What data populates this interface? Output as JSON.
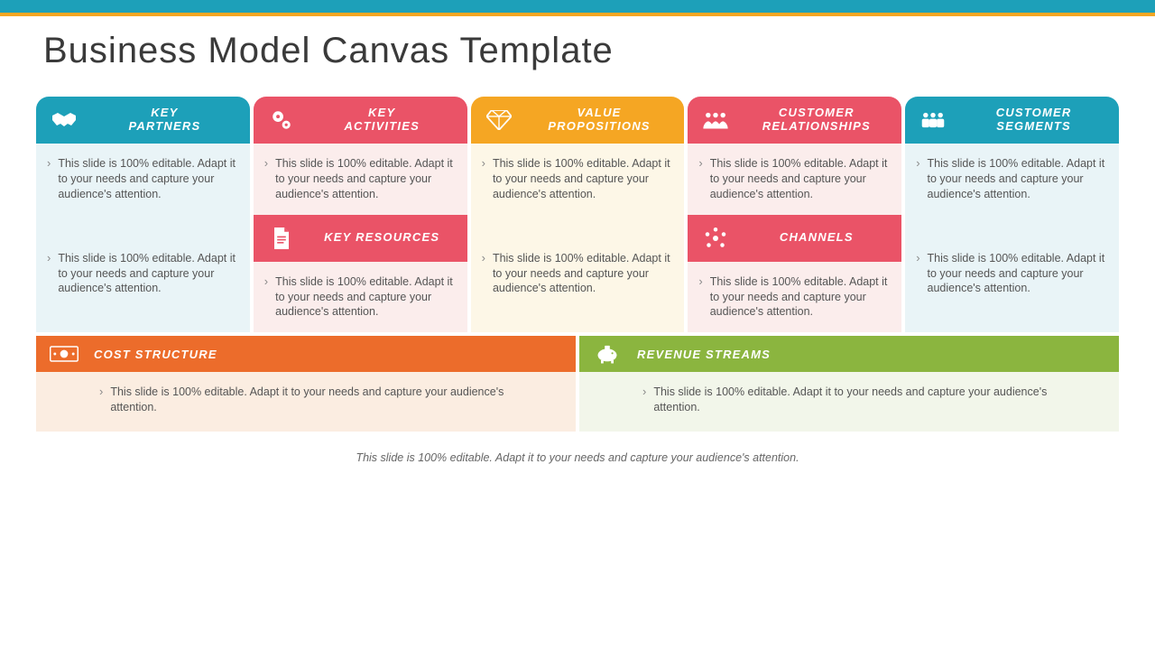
{
  "title": "Business Model Canvas Template",
  "placeholder": "This slide is 100% editable. Adapt it to your needs and capture your audience's attention.",
  "cards": {
    "key_partners": {
      "label": "KEY\nPARTNERS",
      "icon": "handshake-icon"
    },
    "key_activities": {
      "label": "KEY\nACTIVITIES",
      "icon": "gears-icon"
    },
    "value_propositions": {
      "label": "VALUE\nPROPOSITIONS",
      "icon": "diamond-icon"
    },
    "customer_relationships": {
      "label": "CUSTOMER\nRELATIONSHIPS",
      "icon": "people-team-icon"
    },
    "customer_segments": {
      "label": "CUSTOMER\nSEGMENTS",
      "icon": "people-group-icon"
    },
    "key_resources": {
      "label": "KEY RESOURCES",
      "icon": "document-icon"
    },
    "channels": {
      "label": "CHANNELS",
      "icon": "network-icon"
    },
    "cost_structure": {
      "label": "COST STRUCTURE",
      "icon": "money-icon"
    },
    "revenue_streams": {
      "label": "REVENUE STREAMS",
      "icon": "piggy-bank-icon"
    }
  },
  "footer": "This slide is 100% editable. Adapt it to your needs and capture your audience's attention.",
  "colors": {
    "teal": "#1da0b9",
    "pink": "#ea5367",
    "amber": "#f5a623",
    "orange": "#ec6c2b",
    "green": "#8bb53f"
  }
}
